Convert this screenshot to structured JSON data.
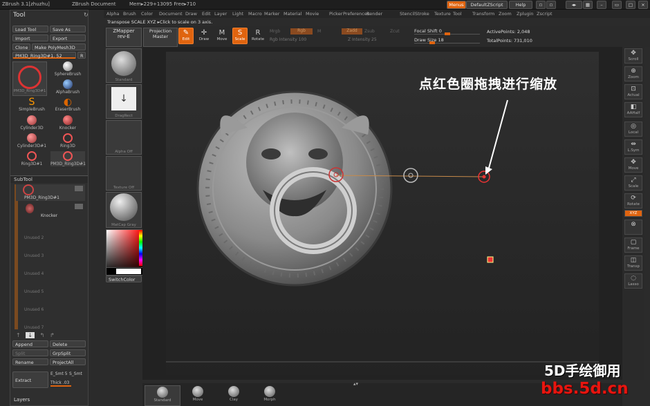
{
  "titlebar": {
    "app": "ZBrush 3.1[zhuzhu]",
    "document": "ZBrush Document",
    "mem": "Mem▸229+13095 Free▸710",
    "menus_btn": "Menus",
    "script_btn": "DefaultZScript",
    "help_btn": "Help"
  },
  "menubar": [
    "Alpha",
    "Brush",
    "Color",
    "Document",
    "Draw",
    "Edit",
    "Layer",
    "Light",
    "Macro",
    "Marker",
    "Material",
    "Movie",
    "Picker",
    "Preferences",
    "Render",
    "Stencil",
    "Stroke",
    "Texture",
    "Tool",
    "Transform",
    "Zoom",
    "Zplugin",
    "Zscript"
  ],
  "status": "Transpose SCALE XYZ ▸Click to scale on 3 axis.",
  "tool_panel": {
    "title": "Tool",
    "load_tool": "Load Tool",
    "save_as": "Save As",
    "import": "Import",
    "export": "Export",
    "clone": "Clone",
    "make_polymesh": "Make PolyMesh3D",
    "current_tool": "PM3D_Ring3D#1. 52",
    "r_btn": "R",
    "brushes": [
      {
        "label": "PM3D_Ring3D#1",
        "kind": "ring-big"
      },
      {
        "label": "SphereBrush",
        "kind": "sphere"
      },
      {
        "label": "AlphaBrush",
        "kind": "alpha"
      },
      {
        "label": "SimpleBrush",
        "kind": "simple"
      },
      {
        "label": "EraserBrush",
        "kind": "eraser"
      },
      {
        "label": "Cylinder3D",
        "kind": "cyl"
      },
      {
        "label": "Knocker",
        "kind": "knocker"
      },
      {
        "label": "Cylinder3D#1",
        "kind": "cyl"
      },
      {
        "label": "Ring3D",
        "kind": "ring"
      },
      {
        "label": "Ring3D#1",
        "kind": "ring"
      },
      {
        "label": "PM3D_Ring3D#1",
        "kind": "ring"
      }
    ],
    "subtool_title": "SubTool",
    "subtools": [
      "PM3D_Ring3D#1",
      "Knocker",
      "Unused 2",
      "Unused 3",
      "Unused 4",
      "Unused 5",
      "Unused 6",
      "Unused 7"
    ],
    "append": "Append",
    "delete": "Delete",
    "split": "Split",
    "grpsplit": "GrpSplit",
    "rename": "Rename",
    "projectall": "ProjectAll",
    "extract": "Extract",
    "e_smt": "E_Smt 5",
    "s_smt": "S_Smt",
    "thick": "Thick .03",
    "layers": "Layers"
  },
  "left_shelf": {
    "zmapper": "ZMapper",
    "zmapper_rev": "rev-E",
    "projection": "Projection",
    "master": "Master",
    "standard": "Standard",
    "dragrect": "DragRect",
    "alpha_off": "Alpha Off",
    "texture_off": "Texture Off",
    "matcap": "MatCap Gray",
    "switchcolor": "SwitchColor"
  },
  "toolbar": {
    "edit": "Edit",
    "draw": "Draw",
    "move": "Move",
    "scale": "Scale",
    "rotate": "Rotate",
    "mrgb": "Mrgb",
    "rgb": "Rgb",
    "m": "M",
    "rgb_intensity": "Rgb Intensity 100",
    "zadd": "Zadd",
    "zsub": "Zsub",
    "zcut": "Zcut",
    "z_intensity": "Z Intensity 25",
    "focal_shift": "Focal Shift 0",
    "draw_size": "Draw Size 18",
    "active_points": "ActivePoints: 2,048",
    "total_points": "TotalPoints: 731,010"
  },
  "right_shelf": [
    "Scroll",
    "Zoom",
    "Actual",
    "AAHalf",
    "Local",
    "L.Sym",
    "Move",
    "Scale",
    "Rotate",
    "XYZ",
    "",
    "Frame",
    "Transp",
    "Lasso"
  ],
  "annotation": "点红色圈拖拽进行缩放",
  "bottom_brushes": [
    "Standard",
    "Move",
    "Clay",
    "Morph"
  ],
  "watermark": {
    "line1": "5D手绘御用",
    "line2": "bbs.5d.cn"
  },
  "colors": {
    "accent": "#e0640f",
    "annotation": "#ffffff",
    "watermark": "#e8150f"
  }
}
